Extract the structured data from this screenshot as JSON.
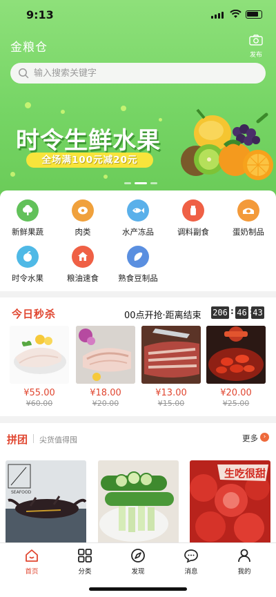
{
  "status_bar": {
    "time": "9:13"
  },
  "header": {
    "app_title": "金粮仓",
    "publish_label": "发布"
  },
  "search": {
    "placeholder": "输入搜索关键字",
    "value": ""
  },
  "banner": {
    "headline": "时令生鲜水果",
    "promo": "全场满100元减20元",
    "slide_count": 3,
    "active_slide": 2
  },
  "categories": [
    {
      "label": "新鲜果蔬",
      "icon": "vegetable-icon",
      "color": "#62c15a"
    },
    {
      "label": "肉类",
      "icon": "meat-icon",
      "color": "#f0a13c"
    },
    {
      "label": "水产冻品",
      "icon": "seafood-icon",
      "color": "#5ab0ea"
    },
    {
      "label": "调料副食",
      "icon": "seasoning-icon",
      "color": "#ef6045"
    },
    {
      "label": "蛋奶制品",
      "icon": "egg-milk-icon",
      "color": "#f39a3a"
    },
    {
      "label": "时令水果",
      "icon": "fruit-icon",
      "color": "#4fb9e6"
    },
    {
      "label": "粮油速食",
      "icon": "grain-oil-icon",
      "color": "#ef6045"
    },
    {
      "label": "熟食豆制品",
      "icon": "deli-icon",
      "color": "#5a8fe0"
    }
  ],
  "flash_sale": {
    "title": "今日秒杀",
    "countdown_label": "00点开抢·距离结束",
    "countdown": {
      "hours": "206",
      "minutes": "46",
      "seconds": "43"
    },
    "products": [
      {
        "price": "¥55.00",
        "original": "¥60.00"
      },
      {
        "price": "¥18.00",
        "original": "¥20.00"
      },
      {
        "price": "¥13.00",
        "original": "¥15.00"
      },
      {
        "price": "¥20.00",
        "original": "¥25.00"
      }
    ]
  },
  "group_buy": {
    "title": "拼团",
    "subtitle": "尖货值得囤",
    "more_label": "更多",
    "seafood_sign": "SEAFOOD",
    "sticker_text": "生吃很甜"
  },
  "tabbar": [
    {
      "label": "首页",
      "icon": "home-icon",
      "active": true
    },
    {
      "label": "分类",
      "icon": "category-icon",
      "active": false
    },
    {
      "label": "发现",
      "icon": "discover-icon",
      "active": false
    },
    {
      "label": "消息",
      "icon": "message-icon",
      "active": false
    },
    {
      "label": "我的",
      "icon": "profile-icon",
      "active": false
    }
  ],
  "colors": {
    "accent": "#e0452f",
    "header_green": "#76d565",
    "promo_yellow": "#f7e43b"
  }
}
